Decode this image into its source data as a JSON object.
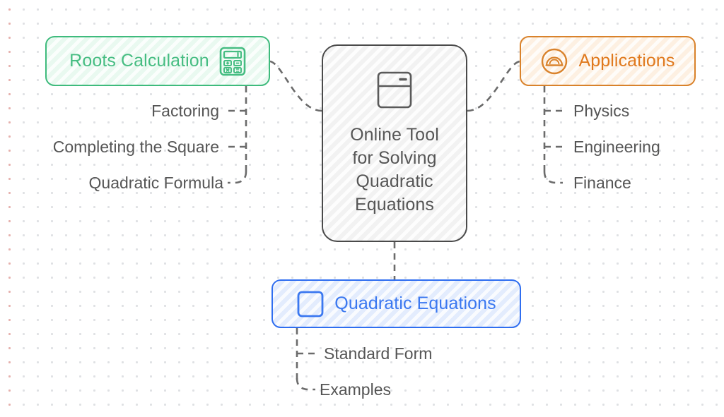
{
  "diagram": {
    "type": "mindmap",
    "center": {
      "label": "Online Tool\nfor Solving\nQuadratic\nEquations",
      "icon": "window-panel-icon",
      "border_color": "#4a4a4a",
      "fill_color": "#f2f2f2",
      "text_color": "#565656"
    },
    "branches": [
      {
        "id": "roots-calculation",
        "label": "Roots Calculation",
        "icon": "calculator-icon",
        "color": "#46bd82",
        "border_color": "#3fbb7d",
        "fill_color": "#e9f9f0",
        "position": "left",
        "children": [
          {
            "label": "Factoring"
          },
          {
            "label": "Completing the Square"
          },
          {
            "label": "Quadratic Formula"
          }
        ]
      },
      {
        "id": "applications",
        "label": "Applications",
        "icon": "archive-dome-circle-icon",
        "color": "#e07a1f",
        "border_color": "#d9822b",
        "fill_color": "#fdf0e2",
        "position": "right",
        "children": [
          {
            "label": "Physics"
          },
          {
            "label": "Engineering"
          },
          {
            "label": "Finance"
          }
        ]
      },
      {
        "id": "quadratic-equations",
        "label": "Quadratic Equations",
        "icon": "square-outline-icon",
        "color": "#3b78f0",
        "border_color": "#2f6ef0",
        "fill_color": "#e3ecfd",
        "position": "bottom",
        "children": [
          {
            "label": "Standard Form"
          },
          {
            "label": "Examples"
          }
        ]
      }
    ],
    "connector": {
      "style": "dashed",
      "color": "#6b6b6b"
    },
    "background": {
      "color": "#ffffff",
      "dot_color": "#969ba5",
      "accent_dot_color": "#f0786e",
      "grid_spacing": 20
    }
  }
}
